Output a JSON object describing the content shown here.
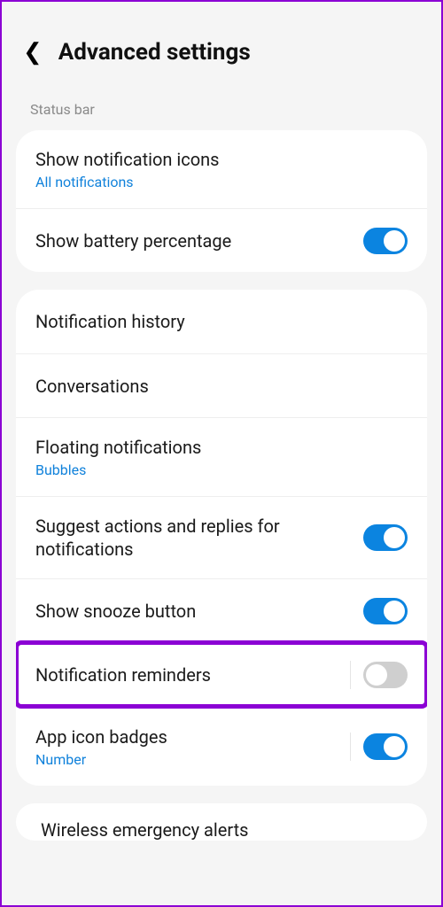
{
  "header": {
    "title": "Advanced settings"
  },
  "sections": {
    "status_bar": {
      "label": "Status bar",
      "show_notification_icons": {
        "title": "Show notification icons",
        "subtitle": "All notifications"
      },
      "show_battery_percentage": {
        "title": "Show battery percentage",
        "toggle": true
      }
    },
    "main": {
      "notification_history": {
        "title": "Notification history"
      },
      "conversations": {
        "title": "Conversations"
      },
      "floating_notifications": {
        "title": "Floating notifications",
        "subtitle": "Bubbles"
      },
      "suggest_actions": {
        "title": "Suggest actions and replies for notifications",
        "toggle": true
      },
      "show_snooze_button": {
        "title": "Show snooze button",
        "toggle": true
      },
      "notification_reminders": {
        "title": "Notification reminders",
        "toggle": false
      },
      "app_icon_badges": {
        "title": "App icon badges",
        "subtitle": "Number",
        "toggle": true
      }
    }
  },
  "truncated_row": "Wireless emergency alerts"
}
